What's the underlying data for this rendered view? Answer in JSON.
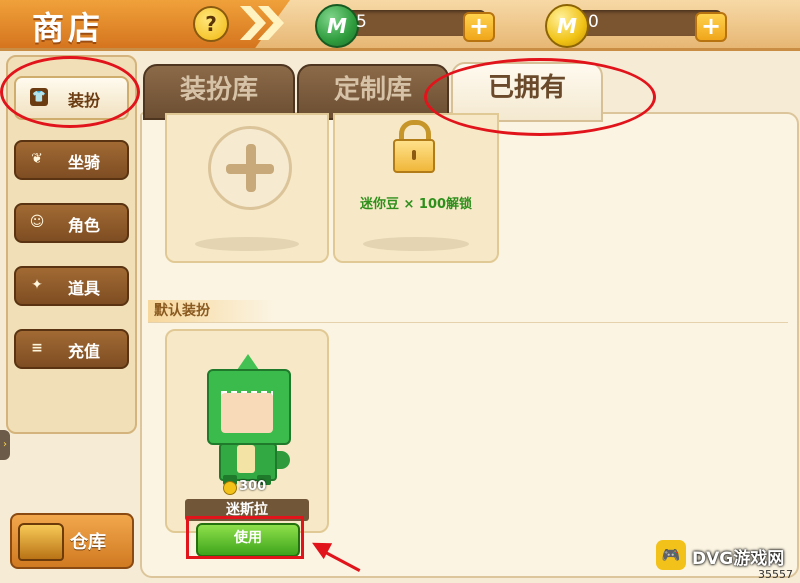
{
  "header": {
    "title": "商店",
    "help_icon": "?"
  },
  "currencies": [
    {
      "name": "mini-bean",
      "symbol": "M",
      "value": "5",
      "color": "#2e9c3d"
    },
    {
      "name": "mini-coin",
      "symbol": "M",
      "value": "0",
      "color": "#f1c316"
    }
  ],
  "sidebar": {
    "items": [
      {
        "label": "装扮",
        "icon": "shirt-icon",
        "active": true
      },
      {
        "label": "坐骑",
        "icon": "wings-icon"
      },
      {
        "label": "角色",
        "icon": "cat-face-icon"
      },
      {
        "label": "道具",
        "icon": "party-popper-icon"
      },
      {
        "label": "充值",
        "icon": "coin-stack-icon"
      }
    ],
    "warehouse_label": "仓库"
  },
  "tabs": [
    {
      "label": "装扮库",
      "active": false
    },
    {
      "label": "定制库",
      "active": false
    },
    {
      "label": "已拥有",
      "active": true
    }
  ],
  "grid": {
    "locked_card_text": "迷你豆 × 100解锁"
  },
  "section": {
    "default_outfits_label": "默认装扮"
  },
  "outfit": {
    "name": "迷斯拉",
    "price": "300",
    "use_label": "使用"
  },
  "watermark": {
    "badge": "🎮",
    "text": "DVG游戏网"
  },
  "corner_id": "35557",
  "colors": {
    "annotation": "#e1141c",
    "use_button": "#3ea41c",
    "brand_orange": "#d5751f"
  }
}
